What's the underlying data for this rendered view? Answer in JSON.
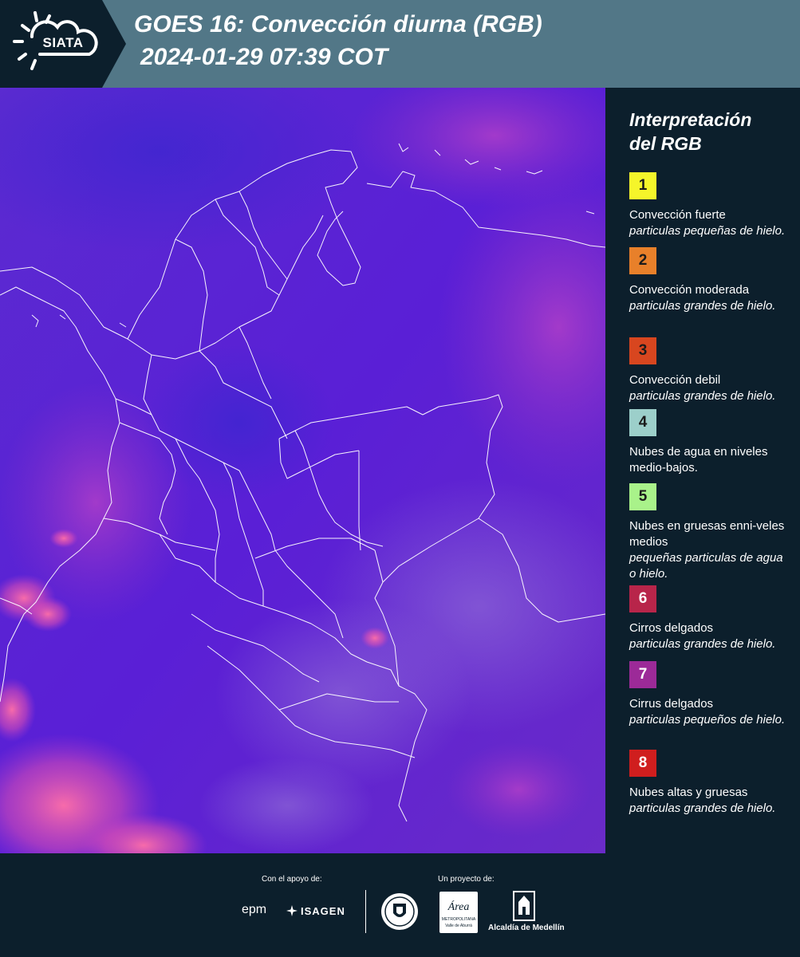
{
  "header": {
    "logo_text": "SIATA",
    "title_line1": "GOES 16: Convección diurna (RGB)",
    "title_line2": "2024-01-29 07:39 COT"
  },
  "legend": {
    "title_line1": "Interpretación",
    "title_line2": "del RGB",
    "items": [
      {
        "num": "1",
        "color": "#f5f52a",
        "name": "Convección fuerte",
        "desc": "particulas pequeñas de hielo."
      },
      {
        "num": "2",
        "color": "#e8802a",
        "name": "Convección moderada",
        "desc": "particulas grandes de hielo."
      },
      {
        "num": "3",
        "color": "#d8461f",
        "name": "Convección debil",
        "desc": "particulas grandes de hielo."
      },
      {
        "num": "4",
        "color": "#9ccfca",
        "name": "Nubes de agua en niveles medio-bajos.",
        "desc": ""
      },
      {
        "num": "5",
        "color": "#a9f28a",
        "name": "Nubes en gruesas enni-veles medios",
        "desc": "pequeñas particulas de agua o hielo."
      },
      {
        "num": "6",
        "color": "#b8254a",
        "name": "Cirros delgados",
        "desc": "particulas grandes de hielo."
      },
      {
        "num": "7",
        "color": "#9c2a98",
        "name": "Cirrus delgados",
        "desc": "particulas pequeños de hielo."
      },
      {
        "num": "8",
        "color": "#d01e1e",
        "name": "Nubes altas y gruesas",
        "desc": "particulas grandes de hielo."
      }
    ]
  },
  "footer": {
    "support_label": "Con el apoyo de:",
    "project_label": "Un proyecto de:",
    "epm": "epm",
    "isagen": "ISAGEN",
    "area_text": "Área",
    "area_sub1": "METROPOLITANA",
    "area_sub2": "Valle de Aburrá",
    "medellin": "Alcaldía de Medellín"
  },
  "colors": {
    "header_bg": "#527787",
    "panel_bg": "#0c1f2c",
    "map_base": "#5a1fd6"
  },
  "icons": [
    "sun-cloud-icon",
    "shield-icon",
    "cathedral-icon",
    "isagen-star-icon"
  ]
}
